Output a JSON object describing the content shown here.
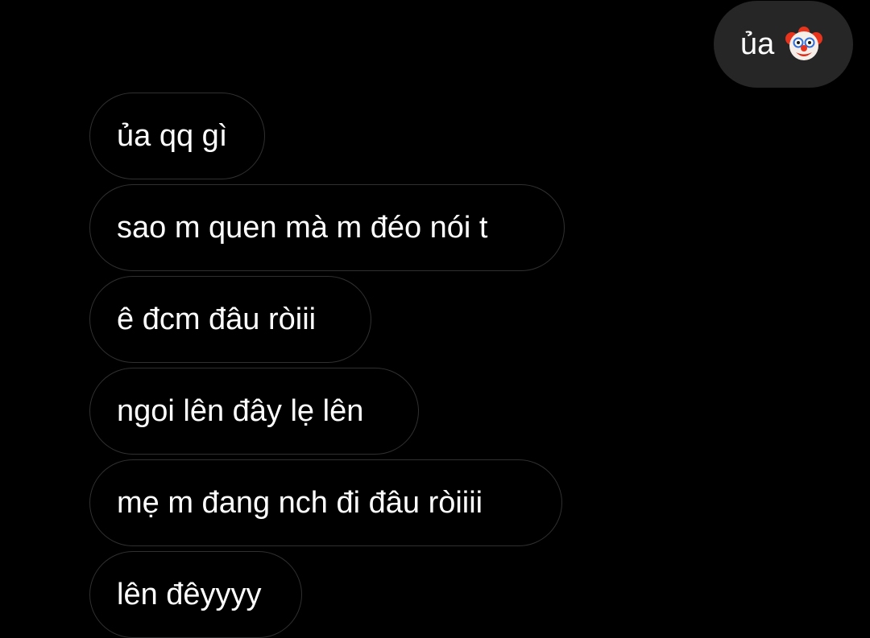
{
  "conversation": {
    "sent": [
      {
        "text": "ủa",
        "emoji": "clown-face-icon"
      }
    ],
    "received": [
      {
        "text": "ủa qq gì"
      },
      {
        "text": "sao m quen mà m đéo nói t"
      },
      {
        "text": "ê đcm đâu ròiii"
      },
      {
        "text": "ngoi lên đây lẹ lên"
      },
      {
        "text": "mẹ m đang nch đi đâu ròiiii"
      },
      {
        "text": "lên đêyyyy"
      }
    ]
  },
  "colors": {
    "background": "#000000",
    "sent_bubble": "#262626",
    "received_border": "#303030",
    "text": "#ffffff"
  }
}
